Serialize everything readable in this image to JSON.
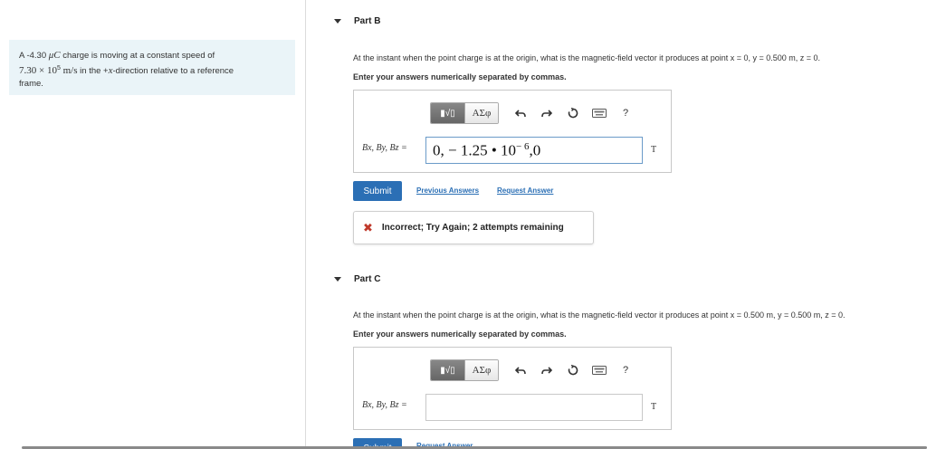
{
  "problem": {
    "line1_prefix": "A -4.30 ",
    "line1_unit": "μC",
    "line1_suffix": " charge is moving at a constant speed of",
    "speed": "7.30 × 10",
    "speed_exp": "5",
    "speed_unit": " m/s",
    "line2_suffix": " in the +",
    "dir_var": "x",
    "line2_end": "-direction relative to a reference",
    "line3": "frame."
  },
  "partB": {
    "title": "Part B",
    "question": "At the instant when the point charge is at the origin, what is the magnetic-field vector it produces at point x = 0, y = 0.500 m, z = 0.",
    "instruction": "Enter your answers numerically separated by commas.",
    "var_label": "Bx, By, Bz =",
    "answer_value": "0, − 1.25 • 10",
    "answer_exp": "− 6",
    "answer_tail": ",0",
    "unit": "T",
    "submit_label": "Submit",
    "prev_answers_label": "Previous Answers",
    "request_answer_label": "Request Answer",
    "feedback": "Incorrect; Try Again; 2 attempts remaining"
  },
  "partC": {
    "title": "Part C",
    "question": "At the instant when the point charge is at the origin, what is the magnetic-field vector it produces at point x = 0.500 m, y = 0.500 m, z = 0.",
    "instruction": "Enter your answers numerically separated by commas.",
    "var_label": "Bx, By, Bz =",
    "answer_value": "",
    "unit": "T",
    "submit_label": "Submit",
    "request_answer_label": "Request Answer"
  },
  "toolbar": {
    "math_label": "▮√▯",
    "greek_label": "ΑΣφ",
    "help_label": "?"
  }
}
